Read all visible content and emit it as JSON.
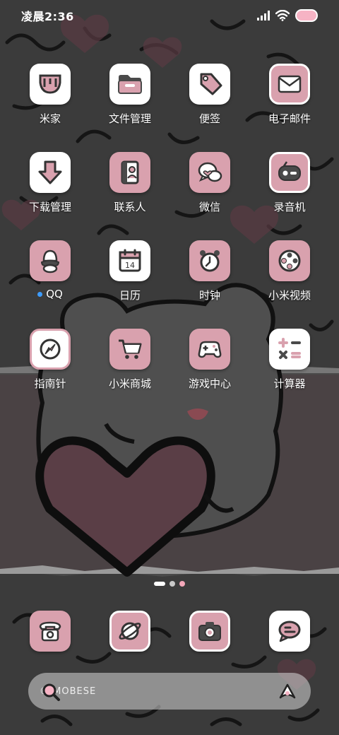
{
  "status_bar": {
    "time": "凌晨2:36",
    "icons": [
      "signal-icon",
      "wifi-icon",
      "battery-icon"
    ]
  },
  "apps": [
    {
      "id": "mijia",
      "label": "米家",
      "icon": "mijia-icon"
    },
    {
      "id": "files",
      "label": "文件管理",
      "icon": "folder-icon"
    },
    {
      "id": "notes",
      "label": "便签",
      "icon": "tag-icon"
    },
    {
      "id": "email",
      "label": "电子邮件",
      "icon": "envelope-icon"
    },
    {
      "id": "downloads",
      "label": "下载管理",
      "icon": "download-arrow-icon"
    },
    {
      "id": "contacts",
      "label": "联系人",
      "icon": "contacts-book-icon"
    },
    {
      "id": "wechat",
      "label": "微信",
      "icon": "chat-heart-icon"
    },
    {
      "id": "recorder",
      "label": "录音机",
      "icon": "recorder-icon"
    },
    {
      "id": "qq",
      "label": "QQ",
      "icon": "penguin-icon"
    },
    {
      "id": "calendar",
      "label": "日历",
      "icon": "calendar-icon",
      "calendar_day": "14"
    },
    {
      "id": "clock",
      "label": "时钟",
      "icon": "alarm-clock-icon"
    },
    {
      "id": "mivideo",
      "label": "小米视频",
      "icon": "film-reel-icon"
    },
    {
      "id": "compass",
      "label": "指南针",
      "icon": "compass-icon"
    },
    {
      "id": "mall",
      "label": "小米商城",
      "icon": "shopping-cart-icon"
    },
    {
      "id": "games",
      "label": "游戏中心",
      "icon": "gamepad-icon"
    },
    {
      "id": "calculator",
      "label": "计算器",
      "icon": "calculator-icon"
    }
  ],
  "dock": [
    {
      "id": "phone",
      "icon": "phone-icon"
    },
    {
      "id": "browser",
      "icon": "planet-icon"
    },
    {
      "id": "camera",
      "icon": "camera-icon"
    },
    {
      "id": "messages",
      "icon": "message-bubble-icon"
    }
  ],
  "search": {
    "text": "© MOBESE",
    "icons": [
      "magnifier-icon",
      "ai-assistant-icon"
    ]
  },
  "colors": {
    "accent_pink": "#d9a1ae",
    "light_pink": "#f6b3c4",
    "icon_dark": "#4a4a4a",
    "wallpaper_bg": "#3a3a3a"
  },
  "page_indicator": [
    "bone-icon",
    "paw-icon",
    "paw-icon"
  ]
}
